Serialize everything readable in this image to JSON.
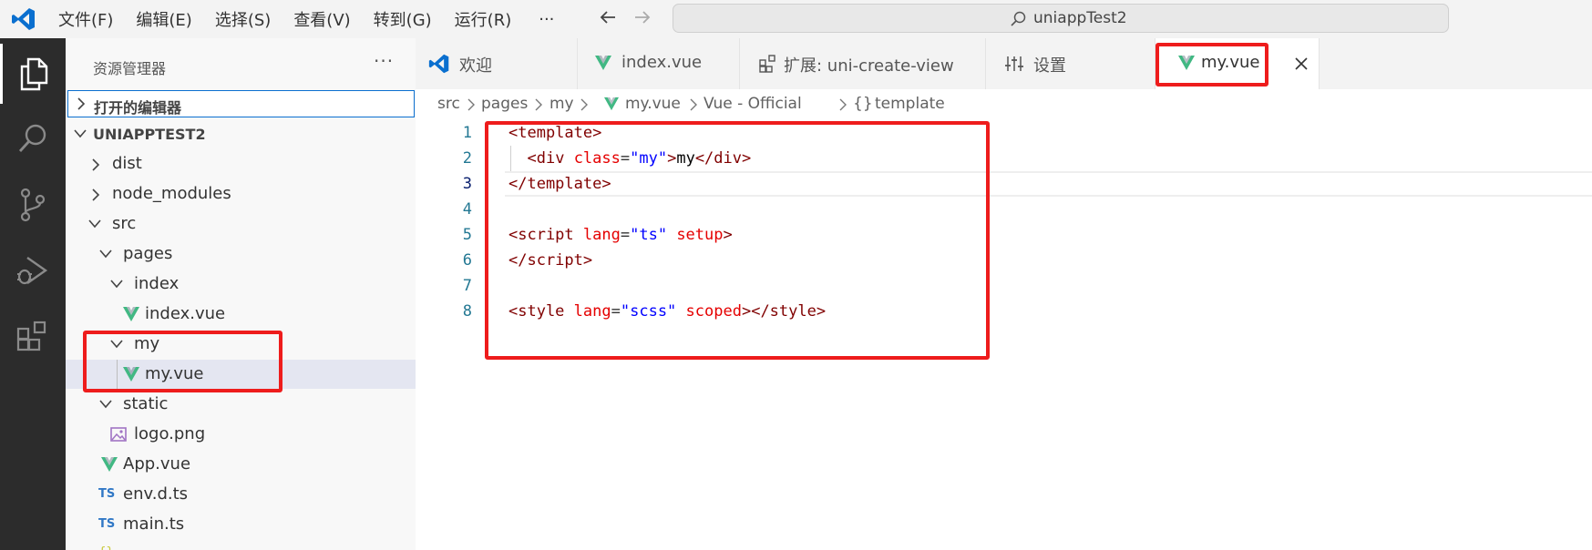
{
  "titlebar": {
    "menu": [
      "文件(F)",
      "编辑(E)",
      "选择(S)",
      "查看(V)",
      "转到(G)",
      "运行(R)",
      "···"
    ],
    "back_icon": "arrow-left-icon",
    "forward_icon": "arrow-right-icon",
    "search_text": "uniappTest2"
  },
  "activity_bar": {
    "items": [
      "explorer-icon",
      "search-icon",
      "source-control-icon",
      "run-debug-icon",
      "extensions-icon"
    ]
  },
  "sidebar": {
    "title": "资源管理器",
    "more": "···",
    "open_editors": "打开的编辑器",
    "project": "UNIAPPTEST2",
    "tree": [
      {
        "label": "dist"
      },
      {
        "label": "node_modules"
      },
      {
        "label": "src"
      },
      {
        "label": "pages"
      },
      {
        "label": "index"
      },
      {
        "label": "index.vue"
      },
      {
        "label": "my"
      },
      {
        "label": "my.vue"
      },
      {
        "label": "static"
      },
      {
        "label": "logo.png"
      },
      {
        "label": "App.vue"
      },
      {
        "label": "env.d.ts"
      },
      {
        "label": "main.ts"
      }
    ],
    "ts_badge": "TS"
  },
  "tabs": [
    {
      "label": "欢迎"
    },
    {
      "label": "index.vue"
    },
    {
      "label": "扩展: uni-create-view"
    },
    {
      "label": "设置"
    },
    {
      "label": "my.vue"
    }
  ],
  "breadcrumb": {
    "items": [
      "src",
      "pages",
      "my",
      "my.vue",
      "Vue - Official",
      "template"
    ],
    "braces": "{}"
  },
  "editor": {
    "current_line": 3,
    "line_numbers": [
      "1",
      "2",
      "3",
      "4",
      "5",
      "6",
      "7",
      "8"
    ]
  },
  "colors": {
    "vue_green": "#41b883",
    "highlight_red": "#ee1c1c",
    "ts_blue": "#3178c6",
    "vscode_blue": "#0a6fcf"
  }
}
